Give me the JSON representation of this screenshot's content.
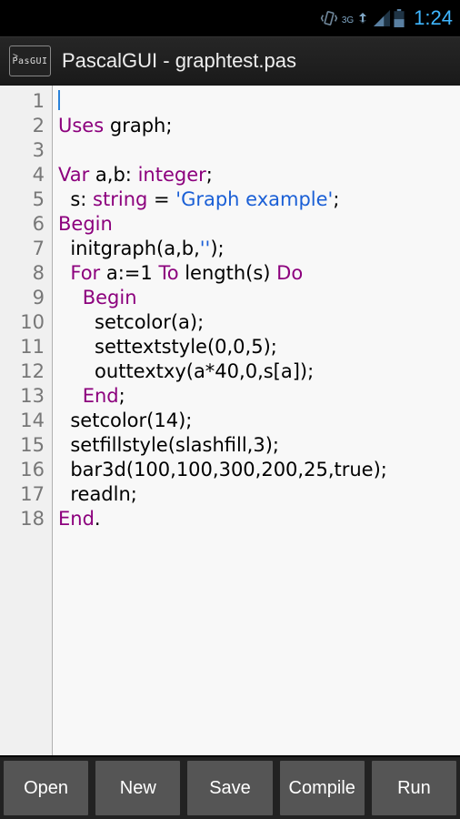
{
  "status": {
    "net_label": "3G",
    "clock": "1:24"
  },
  "title": "PascalGUI - graphtest.pas",
  "app_icon_label": "PasGUI",
  "code_lines": [
    {
      "n": "1",
      "segs": [
        {
          "t": "cursor"
        }
      ]
    },
    {
      "n": "2",
      "segs": [
        {
          "c": "kw",
          "t": "Uses"
        },
        {
          "t": " graph;"
        }
      ]
    },
    {
      "n": "3",
      "segs": []
    },
    {
      "n": "4",
      "segs": [
        {
          "c": "kw",
          "t": "Var"
        },
        {
          "t": " a,b: "
        },
        {
          "c": "ty",
          "t": "integer"
        },
        {
          "t": ";"
        }
      ]
    },
    {
      "n": "5",
      "segs": [
        {
          "t": "  s: "
        },
        {
          "c": "ty",
          "t": "string"
        },
        {
          "t": " = "
        },
        {
          "c": "str",
          "t": "'Graph example'"
        },
        {
          "t": ";"
        }
      ]
    },
    {
      "n": "6",
      "segs": [
        {
          "c": "kw",
          "t": "Begin"
        }
      ]
    },
    {
      "n": "7",
      "segs": [
        {
          "t": "  initgraph(a,b,"
        },
        {
          "c": "str",
          "t": "''"
        },
        {
          "t": ");"
        }
      ]
    },
    {
      "n": "8",
      "segs": [
        {
          "t": "  "
        },
        {
          "c": "kw",
          "t": "For"
        },
        {
          "t": " a:=1 "
        },
        {
          "c": "kw",
          "t": "To"
        },
        {
          "t": " length(s) "
        },
        {
          "c": "kw",
          "t": "Do"
        }
      ]
    },
    {
      "n": "9",
      "segs": [
        {
          "t": "    "
        },
        {
          "c": "kw",
          "t": "Begin"
        }
      ]
    },
    {
      "n": "10",
      "segs": [
        {
          "t": "      setcolor(a);"
        }
      ]
    },
    {
      "n": "11",
      "segs": [
        {
          "t": "      settextstyle(0,0,5);"
        }
      ]
    },
    {
      "n": "12",
      "segs": [
        {
          "t": "      outtextxy(a*40,0,s[a]);"
        }
      ]
    },
    {
      "n": "13",
      "segs": [
        {
          "t": "    "
        },
        {
          "c": "kw",
          "t": "End"
        },
        {
          "t": ";"
        }
      ]
    },
    {
      "n": "14",
      "segs": [
        {
          "t": "  setcolor(14);"
        }
      ]
    },
    {
      "n": "15",
      "segs": [
        {
          "t": "  setfillstyle(slashfill,3);"
        }
      ]
    },
    {
      "n": "16",
      "segs": [
        {
          "t": "  bar3d(100,100,300,200,25,true);"
        }
      ]
    },
    {
      "n": "17",
      "segs": [
        {
          "t": "  readln;"
        }
      ]
    },
    {
      "n": "18",
      "segs": [
        {
          "c": "kw",
          "t": "End"
        },
        {
          "t": "."
        }
      ]
    }
  ],
  "buttons": {
    "open": "Open",
    "new": "New",
    "save": "Save",
    "compile": "Compile",
    "run": "Run"
  }
}
